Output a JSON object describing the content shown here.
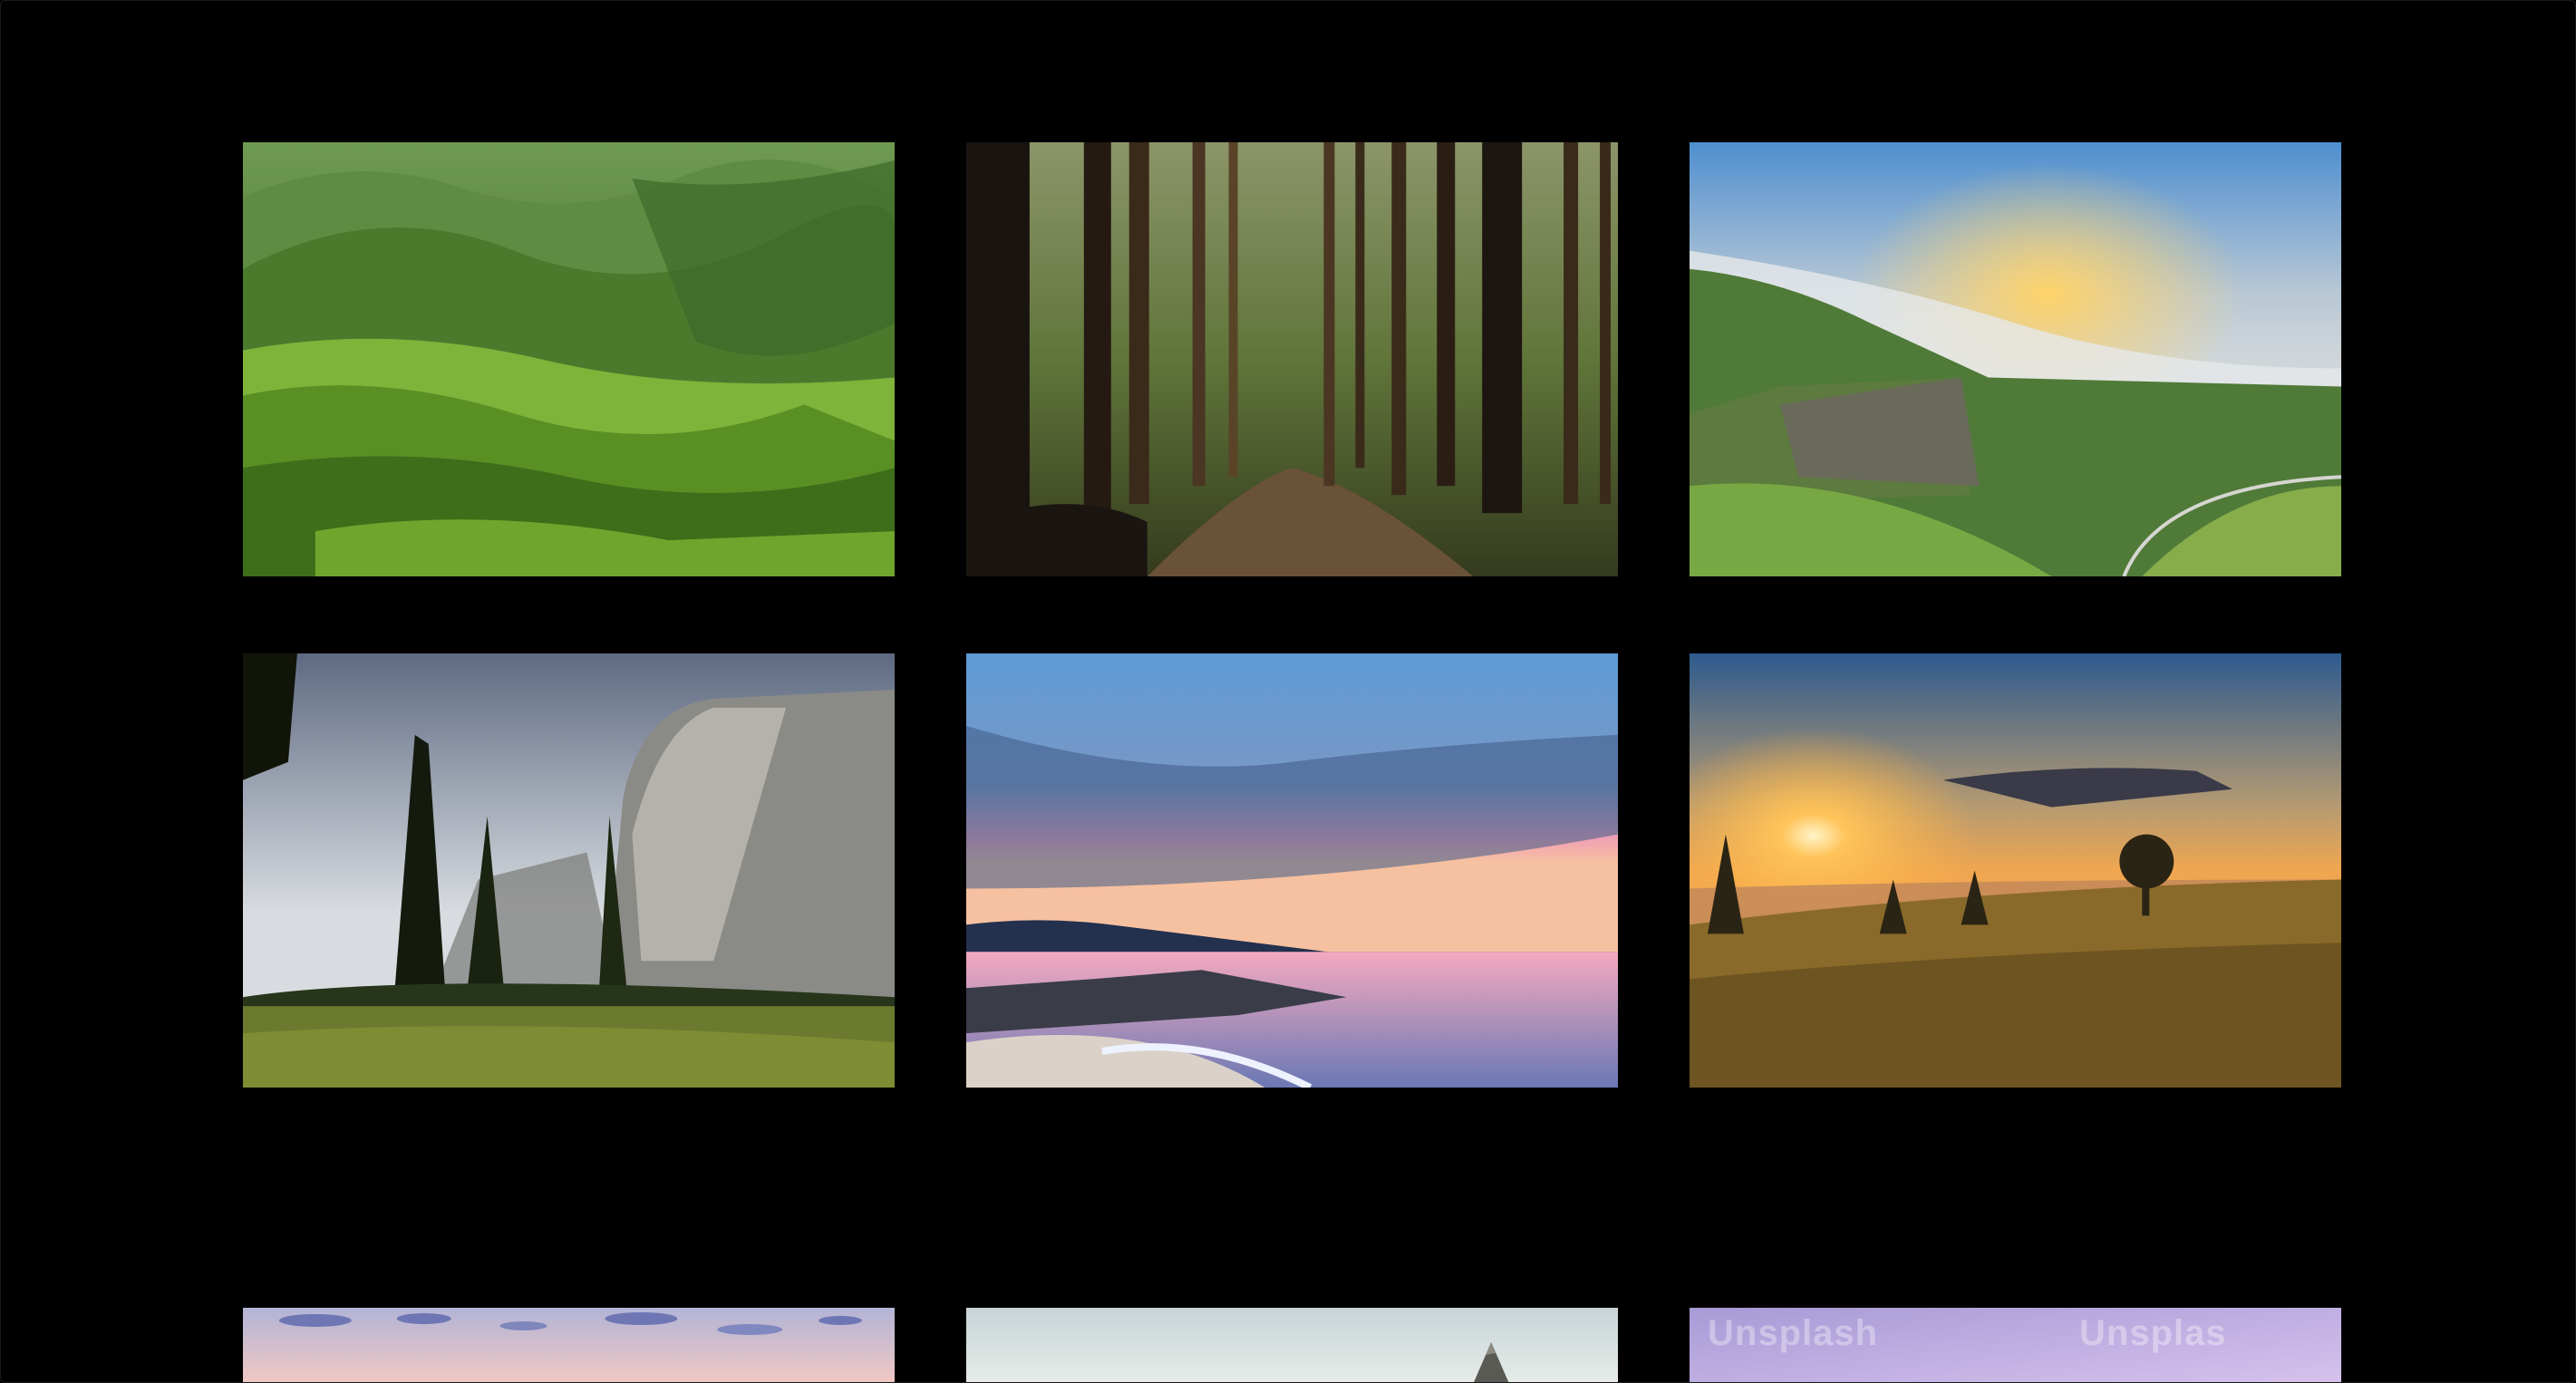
{
  "gallery": {
    "photos": [
      {
        "name": "green-rolling-hills",
        "row": 1,
        "col": 1
      },
      {
        "name": "forest-path",
        "row": 1,
        "col": 2
      },
      {
        "name": "cliff-valley-sunrise",
        "row": 1,
        "col": 3
      },
      {
        "name": "granite-cliff-meadow",
        "row": 2,
        "col": 1
      },
      {
        "name": "pink-sunset-beach",
        "row": 2,
        "col": 2
      },
      {
        "name": "misty-sunrise-hill",
        "row": 2,
        "col": 3
      },
      {
        "name": "pastel-sky",
        "row": 3,
        "col": 1
      },
      {
        "name": "pale-sky-pyramid",
        "row": 3,
        "col": 2
      },
      {
        "name": "purple-sky",
        "row": 3,
        "col": 3
      }
    ],
    "watermark_left": "Unsplash",
    "watermark_right": "Unsplas"
  },
  "colors": {
    "background": "#000000"
  }
}
